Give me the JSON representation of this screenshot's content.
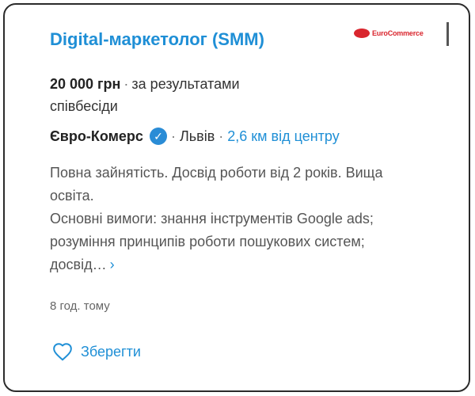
{
  "job": {
    "title": "Digital-маркетолог (SMM)",
    "logo_text": "EuroCommerce",
    "salary_amount": "20 000 грн",
    "salary_sep": "·",
    "salary_note": "за результатами співбесіди",
    "company": "Євро-Комерс",
    "sep": "·",
    "city": "Львів",
    "distance": "2,6 км від центру",
    "description_line1": "Повна зайнятість. Досвід роботи від 2 років. Вища освіта.",
    "description_line2": "Основні вимоги: знання інструментів Google ads; розуміння принципів роботи пошукових систем; досвід…",
    "more_icon": "›",
    "posted": "8 год. тому",
    "save_label": "Зберегти"
  },
  "icons": {
    "verified": "verified-check-icon",
    "save": "heart-outline-icon",
    "more": "chevron-right-icon"
  },
  "colors": {
    "accent": "#1f8fd6",
    "verified": "#2a8cd6",
    "logo": "#d9262e"
  }
}
